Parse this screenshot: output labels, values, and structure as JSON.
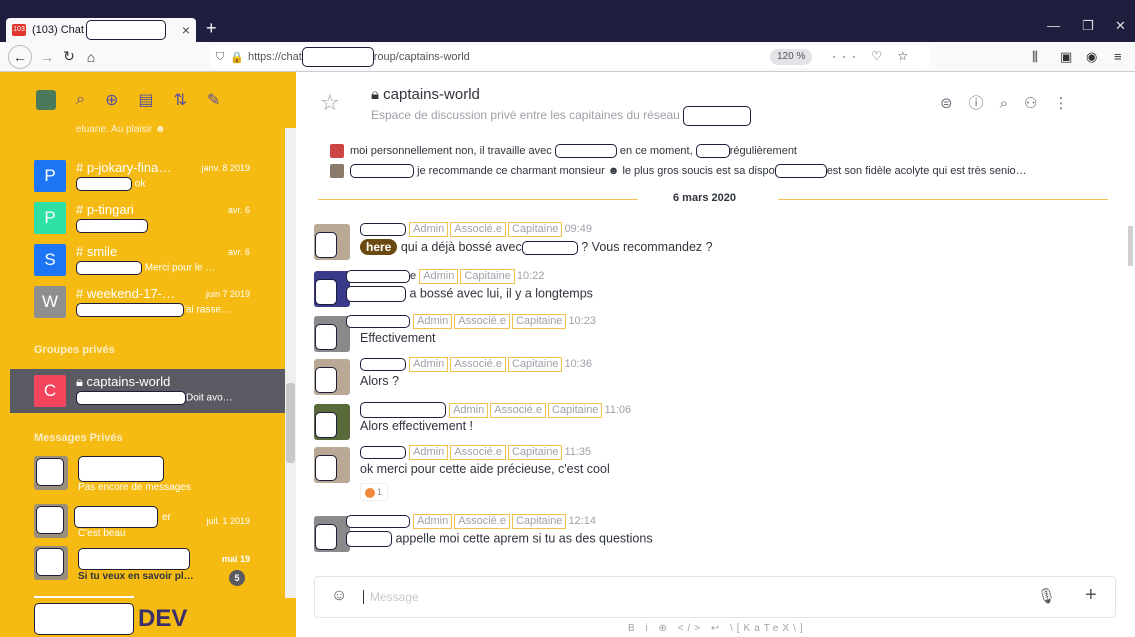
{
  "browser": {
    "tab_title": "(103) Chat",
    "tab_badge": "103",
    "url_prefix": "https://chat",
    "url_suffix": "roup/captains-world",
    "zoom": "120 %",
    "new_tab": "+",
    "close_tab": "×"
  },
  "sidebar": {
    "top_snippet": "eluane. Au plaisir ☻",
    "rooms": [
      {
        "initial": "P",
        "name": "# p-jokary-fina…",
        "date": "janv. 8 2019",
        "msg": "ok",
        "color": "#1d74f5"
      },
      {
        "initial": "P",
        "name": "# p-tingari",
        "date": "avr. 6",
        "msg": "",
        "color": "#2de0a5"
      },
      {
        "initial": "S",
        "name": "# smile",
        "date": "avr. 6",
        "msg": "Merci pour le …",
        "color": "#1d74f5"
      },
      {
        "initial": "W",
        "name": "# weekend-17-…",
        "date": "juin 7 2019",
        "msg": "'ai rasse…",
        "color": "#8f8f8f"
      }
    ],
    "section_private": "Groupes privés",
    "active_room": {
      "initial": "C",
      "name": "captains-world",
      "msg": "Doit avo…",
      "color": "#f5455c"
    },
    "section_dm": "Messages Privés",
    "dms": [
      {
        "msg": "Pas encore de messages",
        "date": ""
      },
      {
        "msg": "C'est beau",
        "date": "juil. 1 2019",
        "name_tail": "er"
      },
      {
        "msg": "Si tu veux en savoir pl…",
        "date": "mai 19",
        "badge": "5"
      }
    ],
    "bottom_label": "DEV"
  },
  "room": {
    "title": "captains-world",
    "topic": "Espace de discussion privé entre les capitaines du réseau"
  },
  "system_lines": [
    {
      "before": "moi personnellement non, il travaille avec",
      "middle": "en ce moment,",
      "after": "régulièrement"
    },
    {
      "before": "je recommande ce charmant monsieur ☻ le plus gros soucis est sa dispo",
      "after": "est son fidèle acolyte qui est très senio…"
    }
  ],
  "date_divider": "6 mars 2020",
  "roles": {
    "admin": "Admin",
    "associe": "Associé.e",
    "capitaine": "Capitaine"
  },
  "messages": [
    {
      "roles": [
        "admin",
        "associe",
        "capitaine"
      ],
      "time": "09:49",
      "here": "here",
      "text": "qui a déjà bossé avec",
      "text_tail": "? Vous recommandez ?"
    },
    {
      "roles": [
        "admin",
        "capitaine"
      ],
      "name_tail": "e",
      "time": "10:22",
      "text": "a bossé avec lui, il y a longtemps"
    },
    {
      "roles": [
        "admin",
        "associe",
        "capitaine"
      ],
      "time": "10:23",
      "text": "Effectivement"
    },
    {
      "roles": [
        "admin",
        "associe",
        "capitaine"
      ],
      "time": "10:36",
      "text": "Alors ?"
    },
    {
      "roles": [
        "admin",
        "associe",
        "capitaine"
      ],
      "time": "11:06",
      "text": "Alors effectivement !"
    },
    {
      "roles": [
        "admin",
        "associe",
        "capitaine"
      ],
      "time": "11:35",
      "text": "ok merci pour cette aide précieuse, c'est cool",
      "reaction_count": "1"
    },
    {
      "roles": [
        "admin",
        "associe",
        "capitaine"
      ],
      "time": "12:14",
      "text": "appelle moi cette aprem si tu as des questions"
    }
  ],
  "composer": {
    "placeholder": "Message",
    "formatting": "B   i   ⊕   </>   ↩   \\[KaTeX\\]"
  }
}
